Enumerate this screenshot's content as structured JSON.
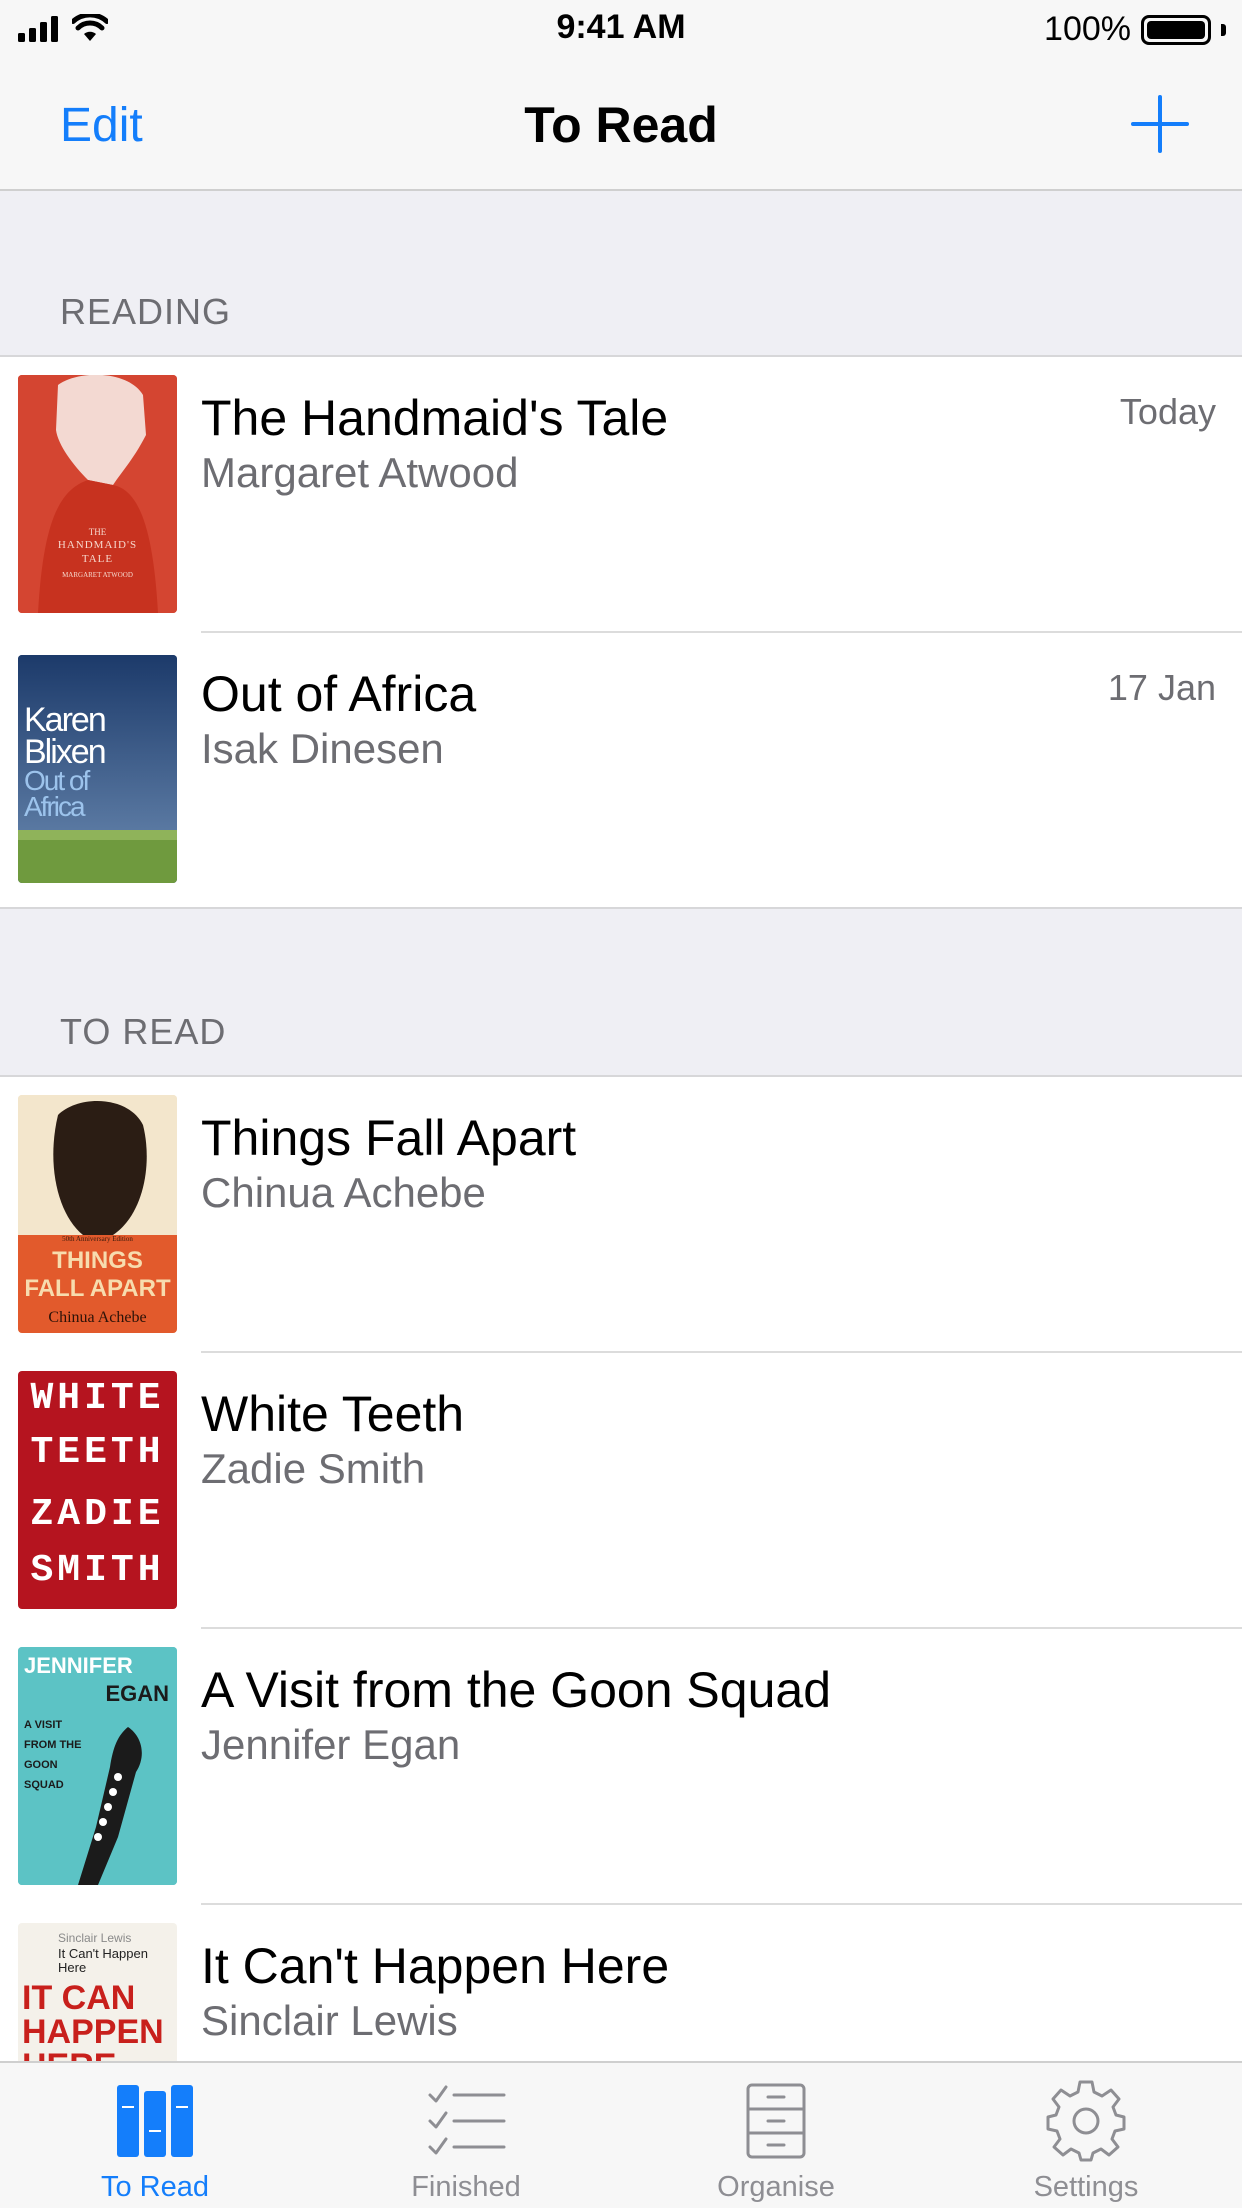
{
  "status_bar": {
    "time": "9:41 AM",
    "battery_text": "100%"
  },
  "nav": {
    "edit_label": "Edit",
    "title": "To Read"
  },
  "sections": [
    {
      "header": "READING"
    },
    {
      "header": "TO READ"
    }
  ],
  "books": [
    {
      "title": "The Handmaid's Tale",
      "author": "Margaret Atwood",
      "date": "Today",
      "cover_lines": [
        "THE",
        "HANDMAID'S",
        "TALE",
        "MARGARET ATWOOD"
      ]
    },
    {
      "title": "Out of Africa",
      "author": "Isak Dinesen",
      "date": "17 Jan",
      "cover_lines": [
        "Karen",
        "Blixen",
        "Out of",
        "Africa"
      ]
    },
    {
      "title": "Things Fall Apart",
      "author": "Chinua Achebe",
      "cover_lines": [
        "50th Anniversary Edition",
        "THINGS",
        "FALL APART",
        "Chinua Achebe"
      ]
    },
    {
      "title": "White Teeth",
      "author": "Zadie Smith",
      "cover_lines": [
        "WHITE",
        "TEETH",
        "ZADIE",
        "SMITH"
      ]
    },
    {
      "title": "A Visit from the Goon Squad",
      "author": "Jennifer Egan",
      "cover_lines": [
        "JENNIFER",
        "EGAN",
        "A VISIT FROM THE GOON SQUAD"
      ]
    },
    {
      "title": "It Can't Happen Here",
      "author": "Sinclair Lewis",
      "cover_lines": [
        "Sinclair Lewis",
        "It Can't Happen Here",
        "IT CAN",
        "HAPPEN",
        "HERE"
      ]
    }
  ],
  "tabs": [
    {
      "label": "To Read",
      "icon": "books-icon",
      "active": true
    },
    {
      "label": "Finished",
      "icon": "checklist-icon",
      "active": false
    },
    {
      "label": "Organise",
      "icon": "cabinet-icon",
      "active": false
    },
    {
      "label": "Settings",
      "icon": "gear-icon",
      "active": false
    }
  ],
  "colors": {
    "accent": "#147efb",
    "secondary_text": "#6d6d72",
    "group_bg": "#efeff4"
  }
}
